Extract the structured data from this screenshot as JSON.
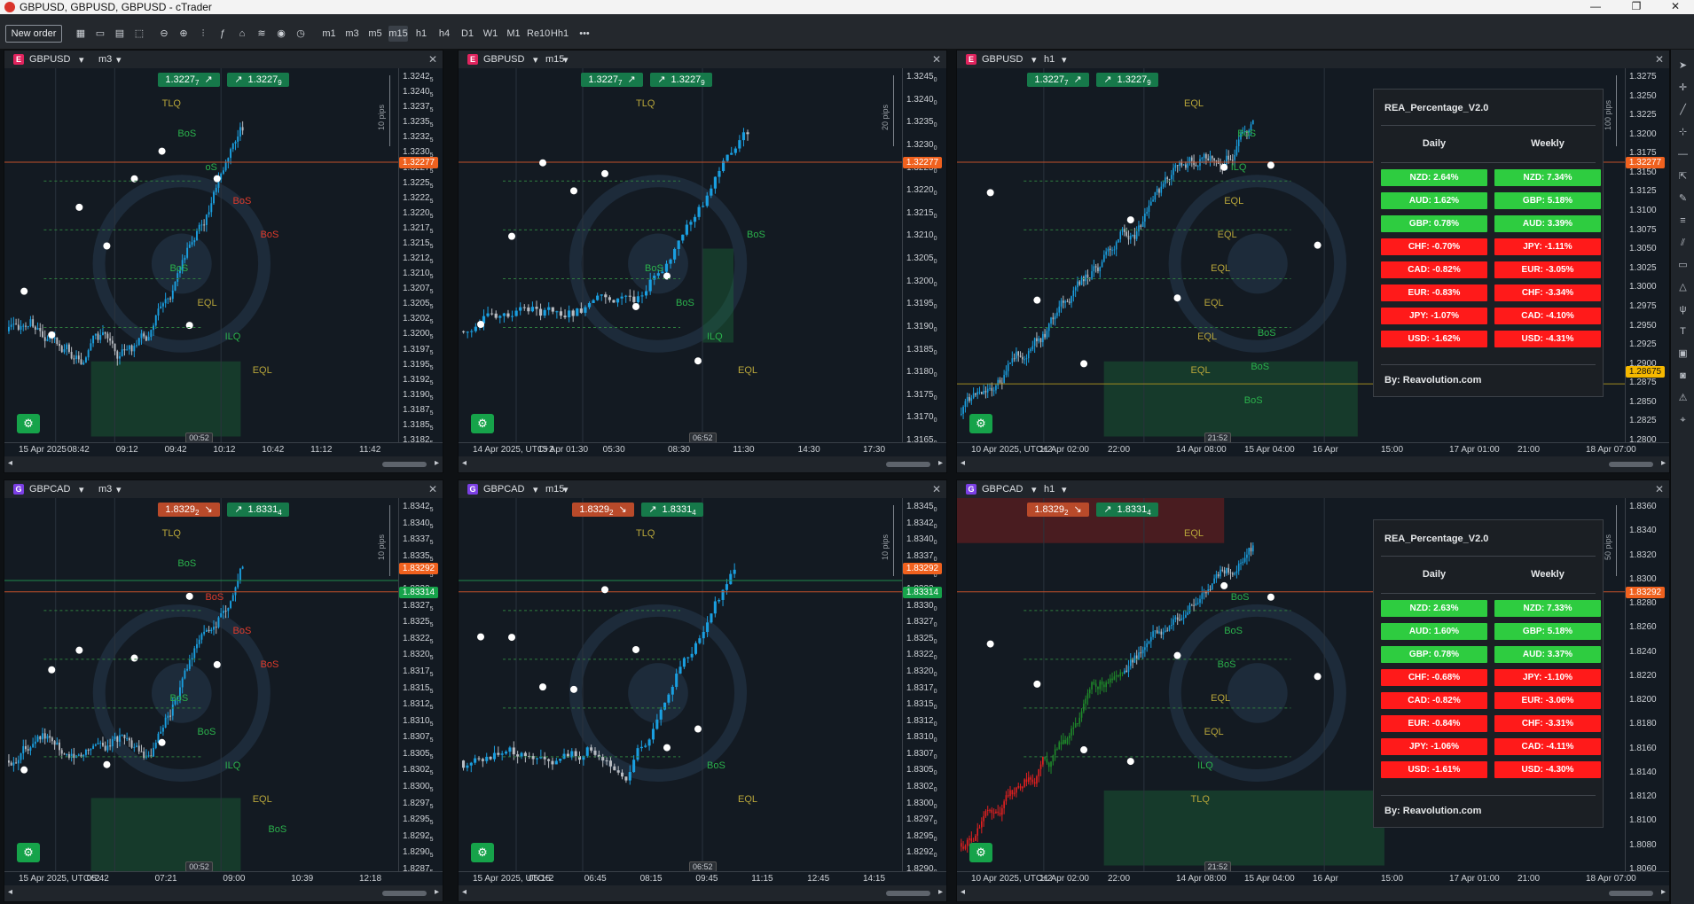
{
  "window": {
    "title": "GBPUSD, GBPUSD, GBPUSD - cTrader",
    "controls": [
      "—",
      "❐",
      "✕"
    ]
  },
  "toolbar": {
    "new_order": "New order",
    "timeframes": [
      "m1",
      "m3",
      "m5",
      "m15",
      "h1",
      "h4",
      "D1",
      "W1",
      "M1",
      "Re10",
      "Hh1"
    ],
    "more": "•••"
  },
  "panels": [
    {
      "id": "p1",
      "badge": "E",
      "badge_color": "#e0245e",
      "symbol": "GBPUSD",
      "tf": "m3",
      "bid": "1.3227",
      "bid_sub": "7",
      "ask": "1.3227",
      "ask_sub": "9",
      "bid_arrow": "↗",
      "ask_arrow": "↗",
      "bid_color": "#16794a",
      "ask_color": "#16794a",
      "ticks": [
        "1.3242",
        "1.3240",
        "1.3237",
        "1.3235",
        "1.3232",
        "1.3230",
        "1.3227",
        "1.3225",
        "1.3222",
        "1.3220",
        "1.3217",
        "1.3215",
        "1.3212",
        "1.3210",
        "1.3207",
        "1.3205",
        "1.3202",
        "1.3200",
        "1.3197",
        "1.3195",
        "1.3192",
        "1.3190",
        "1.3187",
        "1.3185",
        "1.3182"
      ],
      "tick_sub": "5",
      "price_tag": "1.32277",
      "price_tag_color": "#f0611e",
      "price_tag2": "",
      "price_tag2_color": "",
      "times": [
        "15 Apr 2025",
        "08:42",
        "09:12",
        "09:42",
        "10:12",
        "10:42",
        "11:12",
        "11:42"
      ],
      "timer": "00:52",
      "pips": "10 pips",
      "labels": [
        {
          "t": "TLQ",
          "c": "eql"
        },
        {
          "t": "EQL",
          "c": "eql"
        },
        {
          "t": "ILQ",
          "c": "bos"
        },
        {
          "t": "EQL",
          "c": "eql"
        },
        {
          "t": "BoS",
          "c": "bos"
        },
        {
          "t": "BoS",
          "c": "bosr"
        },
        {
          "t": "BoS",
          "c": "bosr"
        },
        {
          "t": "oS",
          "c": "bos"
        },
        {
          "t": "BoS",
          "c": "bos"
        }
      ]
    },
    {
      "id": "p2",
      "badge": "E",
      "badge_color": "#e0245e",
      "symbol": "GBPUSD",
      "tf": "m15",
      "bid": "1.3227",
      "bid_sub": "7",
      "ask": "1.3227",
      "ask_sub": "9",
      "bid_arrow": "↗",
      "ask_arrow": "↗",
      "bid_color": "#16794a",
      "ask_color": "#16794a",
      "ticks": [
        "1.3245",
        "1.3240",
        "1.3235",
        "1.3230",
        "1.3225",
        "1.3220",
        "1.3215",
        "1.3210",
        "1.3205",
        "1.3200",
        "1.3195",
        "1.3190",
        "1.3185",
        "1.3180",
        "1.3175",
        "1.3170",
        "1.3165"
      ],
      "tick_sub": "0",
      "price_tag": "1.32277",
      "price_tag_color": "#f0611e",
      "price_tag2": "",
      "price_tag2_color": "",
      "times": [
        "14 Apr 2025, UTC+2",
        "15 Apr 01:30",
        "05:30",
        "08:30",
        "11:30",
        "14:30",
        "17:30"
      ],
      "timer": "06:52",
      "pips": "20 pips",
      "labels": [
        {
          "t": "TLQ",
          "c": "eql"
        },
        {
          "t": "EQL",
          "c": "eql"
        },
        {
          "t": "ILQ",
          "c": "bos"
        },
        {
          "t": "BoS",
          "c": "bos"
        },
        {
          "t": "BoS",
          "c": "bos"
        },
        {
          "t": "BoS",
          "c": "bos"
        }
      ]
    },
    {
      "id": "p3",
      "badge": "E",
      "badge_color": "#e0245e",
      "symbol": "GBPUSD",
      "tf": "h1",
      "bid": "1.3227",
      "bid_sub": "7",
      "ask": "1.3227",
      "ask_sub": "9",
      "bid_arrow": "↗",
      "ask_arrow": "↗",
      "bid_color": "#16794a",
      "ask_color": "#16794a",
      "ticks": [
        "1.3275",
        "1.3250",
        "1.3225",
        "1.3200",
        "1.3175",
        "1.3150",
        "1.3125",
        "1.3100",
        "1.3075",
        "1.3050",
        "1.3025",
        "1.3000",
        "1.2975",
        "1.2950",
        "1.2925",
        "1.2900",
        "1.2875",
        "1.2850",
        "1.2825",
        "1.2800"
      ],
      "tick_sub": "",
      "price_tag": "1.32277",
      "price_tag_color": "#f0611e",
      "price_tag2": "1.28675",
      "price_tag2_color": "#f5b800",
      "times": [
        "10 Apr 2025, UTC+2",
        "11 Apr 02:00",
        "22:00",
        "14 Apr 08:00",
        "15 Apr 04:00",
        "16 Apr",
        "15:00",
        "17 Apr 01:00",
        "21:00",
        "18 Apr 07:00"
      ],
      "timer": "21:52",
      "pips": "100 pips",
      "labels": [
        {
          "t": "EQL",
          "c": "eql"
        },
        {
          "t": "EQL",
          "c": "eql"
        },
        {
          "t": "EQL",
          "c": "eql"
        },
        {
          "t": "EQL",
          "c": "eql"
        },
        {
          "t": "EQL",
          "c": "eql"
        },
        {
          "t": "EQL",
          "c": "eql"
        },
        {
          "t": "EQL",
          "c": "eql"
        },
        {
          "t": "ILQ",
          "c": "bos"
        },
        {
          "t": "BoS",
          "c": "bos"
        },
        {
          "t": "BoS",
          "c": "bos"
        },
        {
          "t": "BoS",
          "c": "bos"
        },
        {
          "t": "BoS",
          "c": "bos"
        }
      ]
    },
    {
      "id": "p4",
      "badge": "G",
      "badge_color": "#7b3fe4",
      "symbol": "GBPCAD",
      "tf": "m3",
      "bid": "1.8329",
      "bid_sub": "2",
      "ask": "1.8331",
      "ask_sub": "4",
      "bid_arrow": "↘",
      "ask_arrow": "↗",
      "bid_color": "#b94a2a",
      "ask_color": "#16794a",
      "ticks": [
        "1.8342",
        "1.8340",
        "1.8337",
        "1.8335",
        "1.8332",
        "1.8330",
        "1.8327",
        "1.8325",
        "1.8322",
        "1.8320",
        "1.8317",
        "1.8315",
        "1.8312",
        "1.8310",
        "1.8307",
        "1.8305",
        "1.8302",
        "1.8300",
        "1.8297",
        "1.8295",
        "1.8292",
        "1.8290",
        "1.8287"
      ],
      "tick_sub": "5",
      "price_tag": "1.83314",
      "price_tag_color": "#16a34a",
      "price_tag2": "1.83292",
      "price_tag2_color": "#f0611e",
      "times": [
        "15 Apr 2025, UTC+2",
        "05:42",
        "07:21",
        "09:00",
        "10:39",
        "12:18"
      ],
      "timer": "00:52",
      "pips": "10 pips",
      "labels": [
        {
          "t": "TLQ",
          "c": "eql"
        },
        {
          "t": "EQL",
          "c": "eql"
        },
        {
          "t": "ILQ",
          "c": "bos"
        },
        {
          "t": "BoS",
          "c": "bos"
        },
        {
          "t": "BoS",
          "c": "bos"
        },
        {
          "t": "BoS",
          "c": "bosr"
        },
        {
          "t": "BoS",
          "c": "bosr"
        },
        {
          "t": "BoS",
          "c": "bosr"
        },
        {
          "t": "BoS",
          "c": "bos"
        },
        {
          "t": "BoS",
          "c": "bos"
        }
      ]
    },
    {
      "id": "p5",
      "badge": "G",
      "badge_color": "#7b3fe4",
      "symbol": "GBPCAD",
      "tf": "m15",
      "bid": "1.8329",
      "bid_sub": "2",
      "ask": "1.8331",
      "ask_sub": "4",
      "bid_arrow": "↘",
      "ask_arrow": "↗",
      "bid_color": "#b94a2a",
      "ask_color": "#16794a",
      "ticks": [
        "1.8345",
        "1.8342",
        "1.8340",
        "1.8337",
        "1.8335",
        "1.8332",
        "1.8330",
        "1.8327",
        "1.8325",
        "1.8322",
        "1.8320",
        "1.8317",
        "1.8315",
        "1.8312",
        "1.8310",
        "1.8307",
        "1.8305",
        "1.8302",
        "1.8300",
        "1.8297",
        "1.8295",
        "1.8292",
        "1.8290"
      ],
      "tick_sub": "0",
      "price_tag": "1.83314",
      "price_tag_color": "#16a34a",
      "price_tag2": "1.83292",
      "price_tag2_color": "#f0611e",
      "times": [
        "15 Apr 2025, UTC+2",
        "05:15",
        "06:45",
        "08:15",
        "09:45",
        "11:15",
        "12:45",
        "14:15"
      ],
      "timer": "06:52",
      "pips": "10 pips",
      "labels": [
        {
          "t": "TLQ",
          "c": "eql"
        },
        {
          "t": "EQL",
          "c": "eql"
        },
        {
          "t": "BoS",
          "c": "bos"
        }
      ]
    },
    {
      "id": "p6",
      "badge": "G",
      "badge_color": "#7b3fe4",
      "symbol": "GBPCAD",
      "tf": "h1",
      "bid": "1.8329",
      "bid_sub": "2",
      "ask": "1.8331",
      "ask_sub": "4",
      "bid_arrow": "↘",
      "ask_arrow": "↗",
      "bid_color": "#b94a2a",
      "ask_color": "#16794a",
      "ticks": [
        "1.8360",
        "1.8340",
        "1.8320",
        "1.8300",
        "1.8280",
        "1.8260",
        "1.8240",
        "1.8220",
        "1.8200",
        "1.8180",
        "1.8160",
        "1.8140",
        "1.8120",
        "1.8100",
        "1.8080",
        "1.8060"
      ],
      "tick_sub": "",
      "price_tag": "1.83292",
      "price_tag_color": "#f0611e",
      "price_tag2": "",
      "price_tag2_color": "",
      "times": [
        "10 Apr 2025, UTC+2",
        "11 Apr 02:00",
        "22:00",
        "14 Apr 08:00",
        "15 Apr 04:00",
        "16 Apr",
        "15:00",
        "17 Apr 01:00",
        "21:00",
        "18 Apr 07:00"
      ],
      "timer": "21:52",
      "pips": "50 pips",
      "labels": [
        {
          "t": "EQL",
          "c": "eql"
        },
        {
          "t": "TLQ",
          "c": "eql"
        },
        {
          "t": "ILQ",
          "c": "bos"
        },
        {
          "t": "EQL",
          "c": "eql"
        },
        {
          "t": "EQL",
          "c": "eql"
        },
        {
          "t": "BoS",
          "c": "bos"
        },
        {
          "t": "BoS",
          "c": "bos"
        },
        {
          "t": "BoS",
          "c": "bos"
        }
      ]
    }
  ],
  "rea_panels": [
    {
      "title": "REA_Percentage_V2.0",
      "daily_header": "Daily",
      "weekly_header": "Weekly",
      "daily": [
        {
          "t": "NZD: 2.64%",
          "up": true
        },
        {
          "t": "AUD: 1.62%",
          "up": true
        },
        {
          "t": "GBP: 0.78%",
          "up": true
        },
        {
          "t": "CHF: -0.70%",
          "up": false
        },
        {
          "t": "CAD: -0.82%",
          "up": false
        },
        {
          "t": "EUR: -0.83%",
          "up": false
        },
        {
          "t": "JPY: -1.07%",
          "up": false
        },
        {
          "t": "USD: -1.62%",
          "up": false
        }
      ],
      "weekly": [
        {
          "t": "NZD: 7.34%",
          "up": true
        },
        {
          "t": "GBP: 5.18%",
          "up": true
        },
        {
          "t": "AUD: 3.39%",
          "up": true
        },
        {
          "t": "JPY: -1.11%",
          "up": false
        },
        {
          "t": "EUR: -3.05%",
          "up": false
        },
        {
          "t": "CHF: -3.34%",
          "up": false
        },
        {
          "t": "CAD: -4.10%",
          "up": false
        },
        {
          "t": "USD: -4.31%",
          "up": false
        }
      ],
      "by": "By: Reavolution.com"
    },
    {
      "title": "REA_Percentage_V2.0",
      "daily_header": "Daily",
      "weekly_header": "Weekly",
      "daily": [
        {
          "t": "NZD: 2.63%",
          "up": true
        },
        {
          "t": "AUD: 1.60%",
          "up": true
        },
        {
          "t": "GBP: 0.78%",
          "up": true
        },
        {
          "t": "CHF: -0.68%",
          "up": false
        },
        {
          "t": "CAD: -0.82%",
          "up": false
        },
        {
          "t": "EUR: -0.84%",
          "up": false
        },
        {
          "t": "JPY: -1.06%",
          "up": false
        },
        {
          "t": "USD: -1.61%",
          "up": false
        }
      ],
      "weekly": [
        {
          "t": "NZD: 7.33%",
          "up": true
        },
        {
          "t": "GBP: 5.18%",
          "up": true
        },
        {
          "t": "AUD: 3.37%",
          "up": true
        },
        {
          "t": "JPY: -1.10%",
          "up": false
        },
        {
          "t": "EUR: -3.06%",
          "up": false
        },
        {
          "t": "CHF: -3.31%",
          "up": false
        },
        {
          "t": "CAD: -4.11%",
          "up": false
        },
        {
          "t": "USD: -4.30%",
          "up": false
        }
      ],
      "by": "By: Reavolution.com"
    }
  ],
  "colors": {
    "up": "#2ecc40",
    "down": "#ff1a1a",
    "candle_up": "#1a9fe0",
    "candle_down": "#b8bcc2",
    "accent": "#f0611e"
  },
  "right_tools": [
    "cursor-icon",
    "crosshair-icon",
    "line-icon",
    "measure-icon",
    "hline-icon",
    "ray-icon",
    "pencil-icon",
    "fib-icon",
    "channel-icon",
    "rect-icon",
    "triangle-icon",
    "pitchfork-icon",
    "text-icon",
    "note-icon",
    "camera-icon",
    "alert-icon",
    "magnet-icon"
  ]
}
